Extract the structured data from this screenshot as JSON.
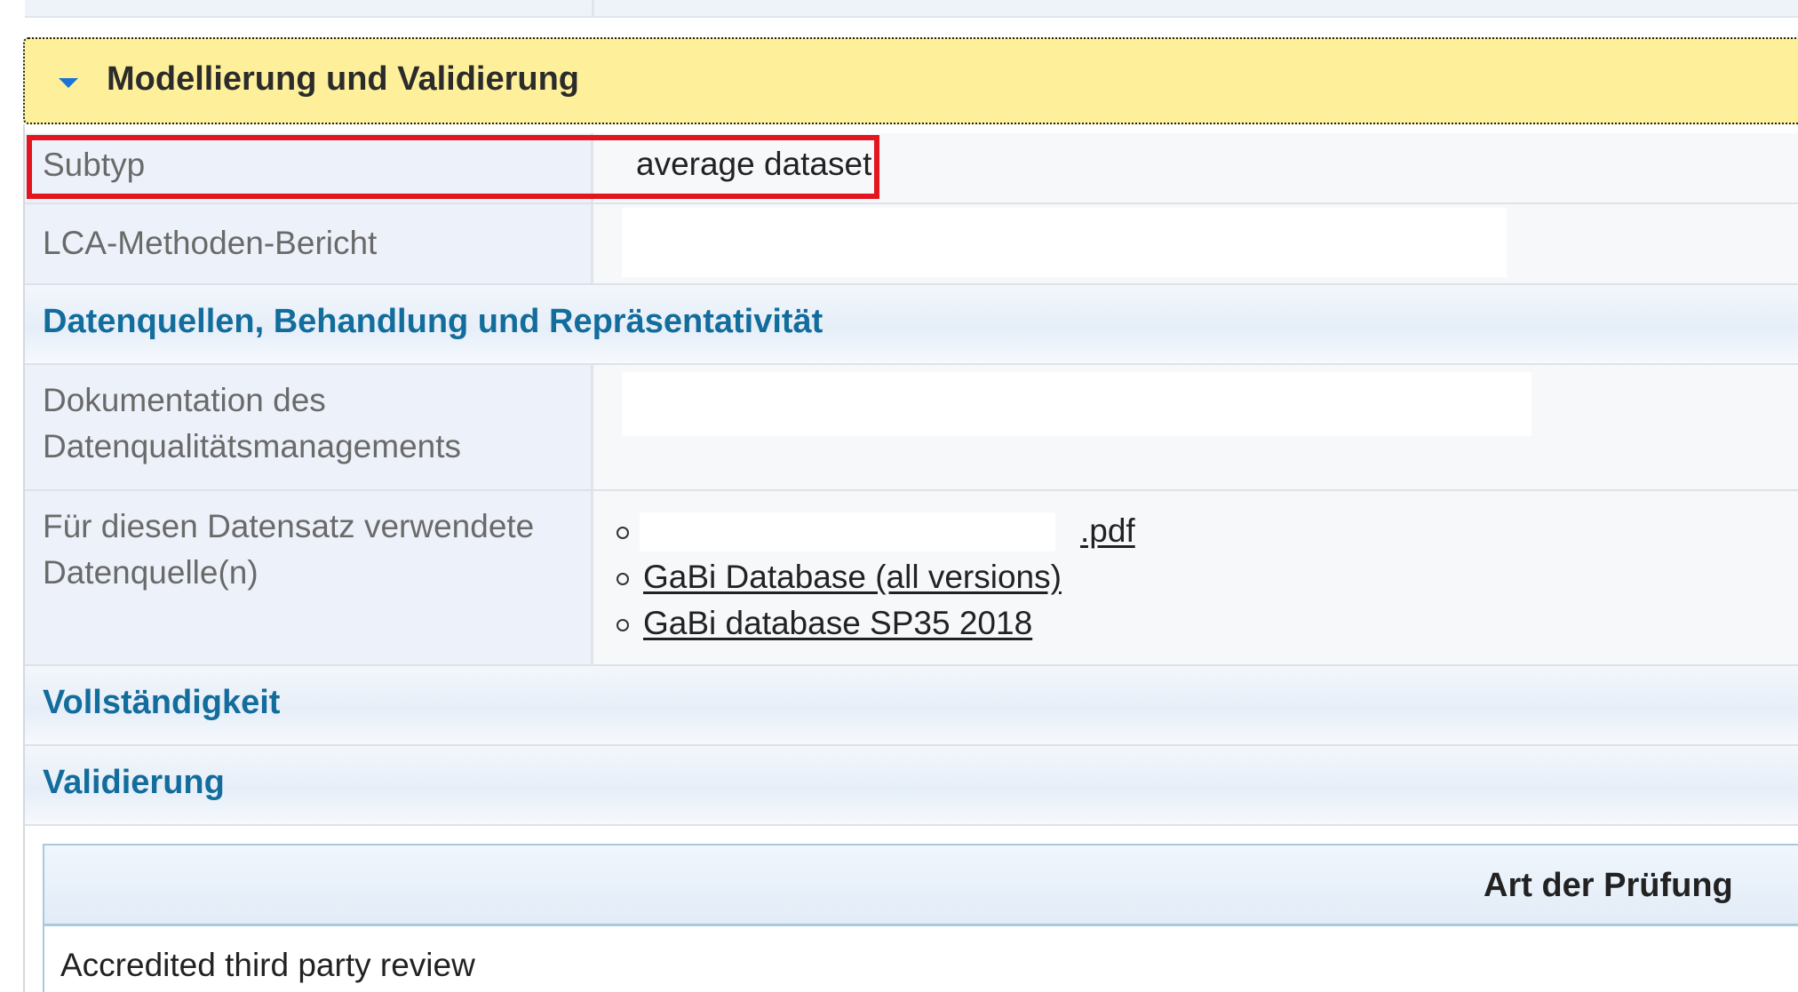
{
  "section": {
    "title": "Modellierung und Validierung"
  },
  "rows": {
    "subtype": {
      "label": "Subtyp",
      "value": "average dataset"
    },
    "lca_report": {
      "label": "LCA-Methoden-Bericht"
    },
    "data_quality": {
      "label_line1": "Dokumentation des",
      "label_line2": "Datenqualitätsmanagements"
    },
    "data_sources": {
      "label_line1": "Für diesen Datensatz verwendete",
      "label_line2": "Datenquelle(n)",
      "items": [
        ".pdf",
        "GaBi Database (all versions)",
        "GaBi database SP35 2018"
      ]
    }
  },
  "subsections": {
    "data_sources": "Datenquellen, Behandlung und Repräsentativität",
    "completeness": "Vollständigkeit",
    "validation": "Validierung"
  },
  "review_table": {
    "header": "Art der Prüfung",
    "rows": [
      "Accredited third party review"
    ]
  },
  "colors": {
    "section_header_bg": "#fef09a",
    "subhead_text": "#136d9c",
    "highlight_border": "#e3161f",
    "caret": "#1a73d6"
  }
}
